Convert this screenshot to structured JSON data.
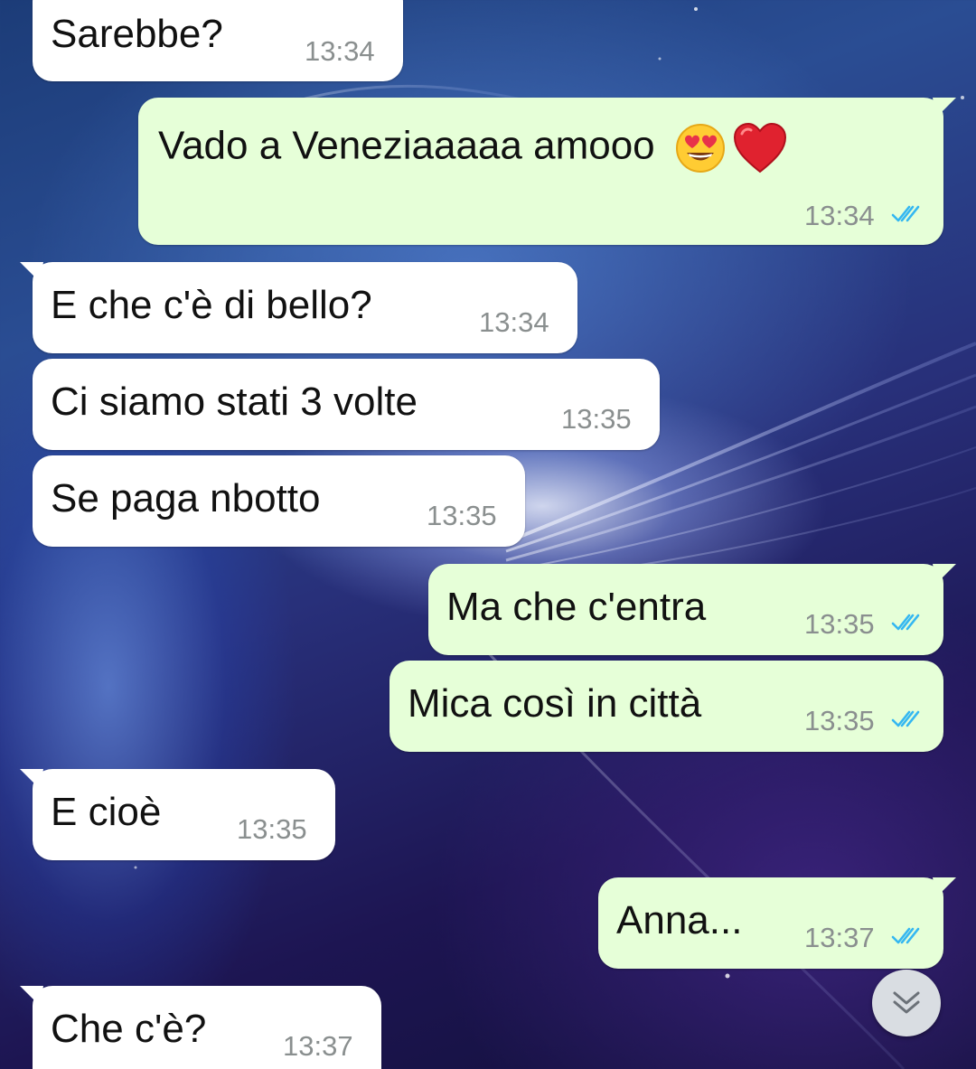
{
  "chat": {
    "messages": [
      {
        "text": "Sarebbe?",
        "time": "13:34",
        "direction": "incoming"
      },
      {
        "text": "Vado a Veneziaaaaa amooo",
        "emoji": [
          "smiling-face-with-heart-eyes",
          "red-heart"
        ],
        "time": "13:34",
        "direction": "outgoing",
        "status": "read"
      },
      {
        "text": "E che c'è di bello?",
        "time": "13:34",
        "direction": "incoming"
      },
      {
        "text": "Ci siamo stati 3 volte",
        "time": "13:35",
        "direction": "incoming"
      },
      {
        "text": "Se paga nbotto",
        "time": "13:35",
        "direction": "incoming"
      },
      {
        "text": "Ma che c'entra",
        "time": "13:35",
        "direction": "outgoing",
        "status": "read"
      },
      {
        "text": "Mica così in città",
        "time": "13:35",
        "direction": "outgoing",
        "status": "read"
      },
      {
        "text": "E cioè",
        "time": "13:35",
        "direction": "incoming"
      },
      {
        "text": "Anna...",
        "time": "13:37",
        "direction": "outgoing",
        "status": "read"
      },
      {
        "text": "Che c'è?",
        "time": "13:37",
        "direction": "incoming"
      }
    ]
  },
  "scroll_button": {
    "icon": "double-chevron-down-icon"
  },
  "colors": {
    "incoming_bubble": "#ffffff",
    "outgoing_bubble": "#e6ffd8",
    "read_ticks": "#34b7f1",
    "timestamp": "#8a8f8f"
  }
}
